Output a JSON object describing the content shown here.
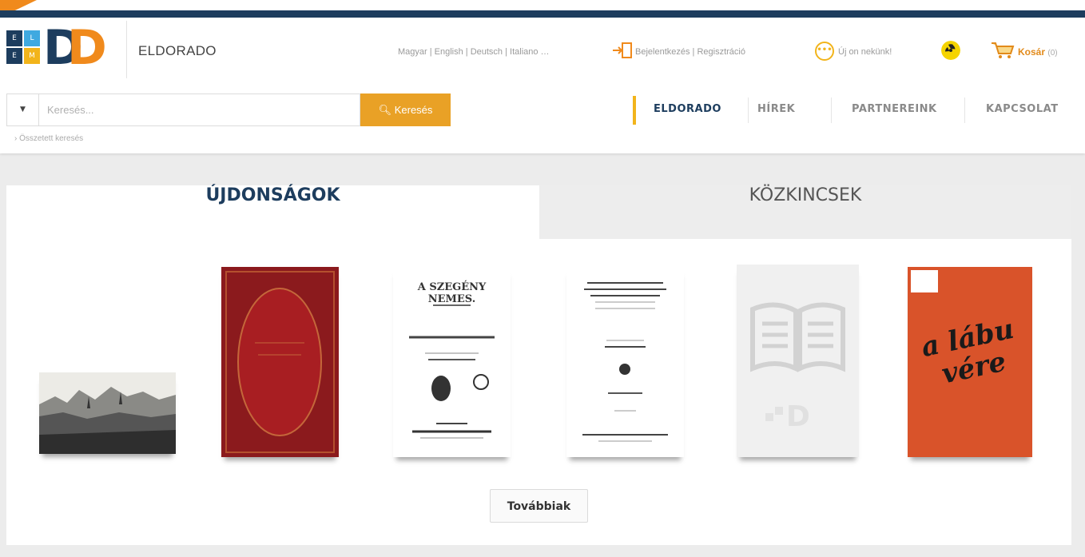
{
  "brand": {
    "site_name": "ELDORADO",
    "logo_letters": [
      "E",
      "L",
      "E",
      "M"
    ],
    "logo_d": "D",
    "colors": {
      "navy": "#1d3d5e",
      "orange": "#f08a1c",
      "yellow": "#f2b41b",
      "search": "#e9a126"
    }
  },
  "header": {
    "languages": "Magyar | English | Deutsch | Italiano …",
    "auth": "Bejelentkezés | Regisztráció",
    "messages": "Új on nekünk!",
    "cart_label": "Kosár",
    "cart_count": "(0)"
  },
  "search": {
    "placeholder": "Keresés...",
    "button_label": "Keresés",
    "caret": "▼",
    "details_link": "Összetett keresés"
  },
  "nav": {
    "items": [
      {
        "label": "ELDORADO"
      },
      {
        "label": "HÍREK"
      },
      {
        "label": "PARTNEREINK"
      },
      {
        "label": "KAPCSOLAT"
      }
    ]
  },
  "tabs": {
    "new": "ÚJDONSÁGOK",
    "public": "KÖZKINCSEK"
  },
  "books": {
    "b3_title": "A SZEGÉNY NEMES.",
    "b6_title": "a lábu vére",
    "placeholder_logo": "D"
  },
  "more_button": "Továbbiak"
}
